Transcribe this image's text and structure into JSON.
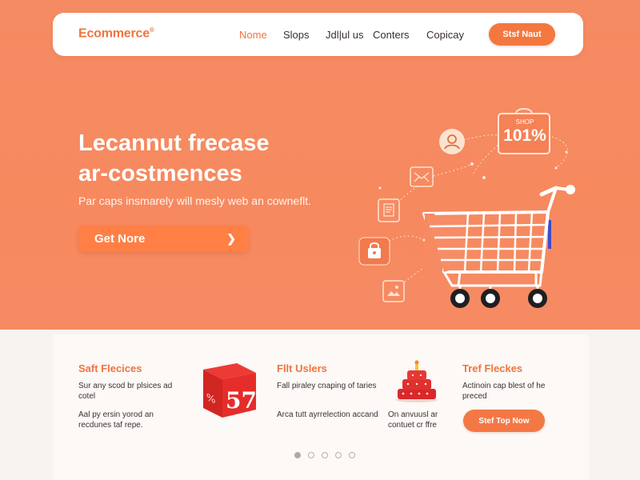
{
  "brand": {
    "logo": "Ecommerce",
    "logo_mark": "®",
    "accent": "#f0743f",
    "hero_bg": "#f78a61"
  },
  "nav": {
    "links": [
      {
        "label": "Nome",
        "active": true
      },
      {
        "label": "Slops"
      },
      {
        "label": "Jdl|ul us"
      },
      {
        "label": "Conters"
      },
      {
        "label": "Copicay"
      }
    ],
    "cta": "Stsf Naut"
  },
  "hero": {
    "title_line1": "Lecannut frecase",
    "title_line2": "ar-costmences",
    "subtitle": "Par caps insmarely will mesly web an cowneflt.",
    "cta": "Get Nore",
    "cta_icon": "chevron-right-icon"
  },
  "illustration": {
    "badge_small": "SHOP",
    "badge_big": "101%",
    "icons": [
      "user-icon",
      "mail-icon",
      "document-icon",
      "lock-icon",
      "image-icon",
      "shopping-bag-icon",
      "shopping-cart-icon"
    ]
  },
  "features": [
    {
      "title": "Saft Flecices",
      "text1": "Sur any scod br plsices ad cotel",
      "text2": "Aal py ersin yorod an recdunes taf repe."
    },
    {
      "title": "Fllt Uslers",
      "text1": "Fall piraley cnaping of taries",
      "text2": "Arca tutt ayrrelection accand",
      "image_text": "57"
    },
    {
      "title": "Tref Fleckes",
      "text1": "Actinoin cap blest of he preced",
      "text2": "On anvuusl ar contuet cr ffre",
      "button": "Stef Top Now"
    }
  ],
  "pagination": {
    "count": 5,
    "active_index": 0
  }
}
